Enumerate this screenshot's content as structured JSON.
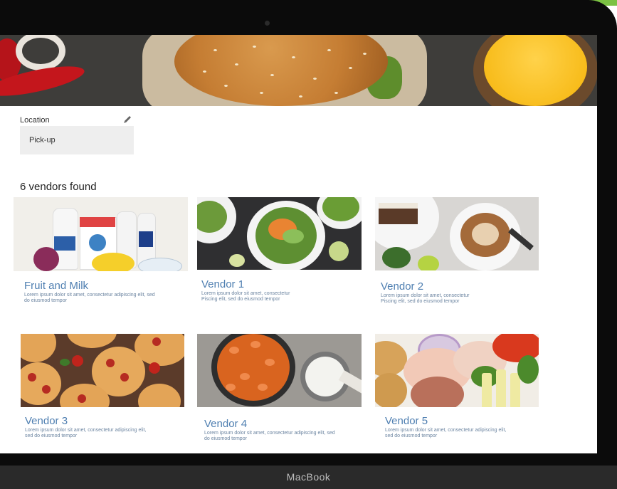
{
  "device": {
    "brand": "MacBook"
  },
  "location": {
    "label": "Location",
    "value": "Pick-up"
  },
  "results": {
    "heading": "6 vendors found"
  },
  "vendors": [
    {
      "name": "Fruit and Milk",
      "desc_line1": "Lorem ipsum dolor sit amet, consectetur adipiscing elit, sed",
      "desc_line2": "do eiusmod tempor"
    },
    {
      "name": "Vendor 1",
      "desc_line1": "Lorem ipsum dolor sit amet, consectetur",
      "desc_line2": "Piscing elit, sed do eiusmod tempor"
    },
    {
      "name": "Vendor 2",
      "desc_line1": "Lorem ipsum dolor sit amet, consectetur",
      "desc_line2": "Piscing elit, sed do eiusmod tempor"
    },
    {
      "name": "Vendor 3",
      "desc_line1": "Lorem ipsum dolor sit amet, consectetur adipiscing elit,",
      "desc_line2": "sed do eiusmod tempor"
    },
    {
      "name": "Vendor 4",
      "desc_line1": "Lorem ipsum dolor sit amet, consectetur adipiscing elit, sed",
      "desc_line2": "do eiusmod tempor"
    },
    {
      "name": "Vendor 5",
      "desc_line1": "Lorem ipsum dolor sit amet, consectetur adipiscing elit,",
      "desc_line2": "sed do eiusmod tempor"
    }
  ],
  "colors": {
    "accent": "#7bc143",
    "link": "#4f7fb1",
    "field_bg": "#eeeeee"
  }
}
